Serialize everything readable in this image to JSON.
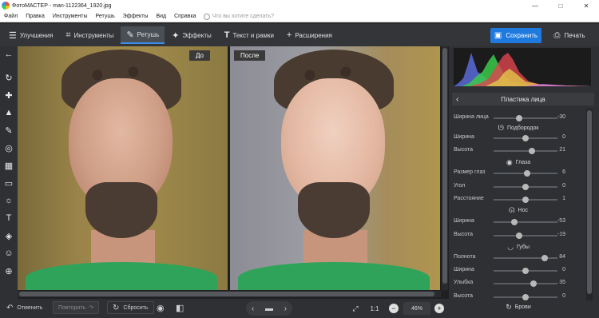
{
  "window": {
    "app_name": "ФотоМАСТЕР",
    "file_name": "man-1122364_1920.jpg",
    "title_separator": " - ",
    "controls": [
      "—",
      "□",
      "✕"
    ]
  },
  "menu": {
    "items": [
      "Файл",
      "Правка",
      "Инструменты",
      "Ретушь",
      "Эффекты",
      "Вид",
      "Справка"
    ],
    "search_placeholder": "Что вы хотите сделать?"
  },
  "toolbar": {
    "tabs": [
      {
        "label": "Улучшения",
        "icon": "sliders-icon"
      },
      {
        "label": "Инструменты",
        "icon": "crop-icon"
      },
      {
        "label": "Ретушь",
        "icon": "brush-icon"
      },
      {
        "label": "Эффекты",
        "icon": "wand-icon"
      },
      {
        "label": "Текст и рамки",
        "icon": "text-icon"
      },
      {
        "label": "Расширения",
        "icon": "plus-icon"
      }
    ],
    "active_tab": "Ретушь",
    "save_label": "Сохранить",
    "print_label": "Печать"
  },
  "canvas": {
    "before_label": "До",
    "after_label": "После"
  },
  "panel": {
    "title": "Пластика лица",
    "sections": [
      {
        "name": "Подбородок",
        "icon": "chin-icon"
      },
      {
        "name": "Глаза",
        "icon": "eye-icon"
      },
      {
        "name": "Нос",
        "icon": "nose-icon"
      },
      {
        "name": "Губы",
        "icon": "lips-icon"
      },
      {
        "name": "Брови",
        "icon": "eyebrow-icon"
      }
    ],
    "sliders": [
      {
        "label": "Ширина лица",
        "value": "-30",
        "level": -0.3
      },
      {
        "label": "Ширина",
        "value": "0",
        "level": 0
      },
      {
        "label": "Высота",
        "value": "21",
        "level": 0.21
      },
      {
        "label": "Размер глаз",
        "value": "6",
        "level": 0.06
      },
      {
        "label": "Угол",
        "value": "0",
        "level": 0
      },
      {
        "label": "Расстояние",
        "value": "1",
        "level": 0.01
      },
      {
        "label": "Ширина",
        "value": "-53",
        "level": -0.53
      },
      {
        "label": "Высота",
        "value": "-19",
        "level": -0.19
      },
      {
        "label": "Полнота",
        "value": "84",
        "level": 0.84
      },
      {
        "label": "Ширина",
        "value": "0",
        "level": 0
      },
      {
        "label": "Улыбка",
        "value": "35",
        "level": 0.35
      },
      {
        "label": "Высота",
        "value": "0",
        "level": 0
      }
    ]
  },
  "bottom": {
    "undo_label": "Отменить",
    "redo_label": "Повторить",
    "reset_label": "Сбросить",
    "ratio_label": "1:1",
    "zoom_value": "46%"
  },
  "colors": {
    "accent": "#1f7ae0",
    "active_tab_underline": "#3b8ee8"
  }
}
